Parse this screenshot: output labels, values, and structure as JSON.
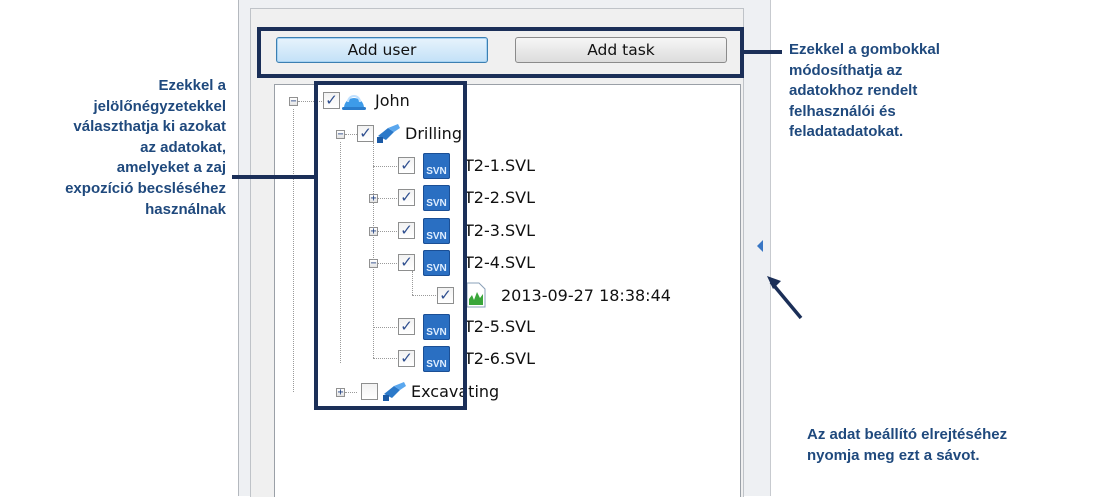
{
  "buttons": {
    "add_user": "Add user",
    "add_task": "Add task"
  },
  "tree": {
    "user": {
      "label": "John",
      "checked": true,
      "icon": "user-helmet-icon"
    },
    "task1": {
      "label": "Drilling",
      "checked": true,
      "icon": "drill-icon"
    },
    "files": [
      {
        "label": "T2-1.SVL",
        "checked": true,
        "icon": "svn-file-icon"
      },
      {
        "label": "T2-2.SVL",
        "checked": true,
        "icon": "svn-file-icon"
      },
      {
        "label": "T2-3.SVL",
        "checked": true,
        "icon": "svn-file-icon"
      },
      {
        "label": "T2-4.SVL",
        "checked": true,
        "icon": "svn-file-icon"
      }
    ],
    "measurement": {
      "label": "2013-09-27 18:38:44",
      "checked": true,
      "icon": "chart-document-icon"
    },
    "files2": [
      {
        "label": "T2-5.SVL",
        "checked": true,
        "icon": "svn-file-icon"
      },
      {
        "label": "T2-6.SVL",
        "checked": true,
        "icon": "svn-file-icon"
      }
    ],
    "task2": {
      "label": "Excavating",
      "checked": false,
      "icon": "drill-icon"
    },
    "svn_badge": "SVN"
  },
  "callouts": {
    "left": [
      "Ezekkel a",
      "jelölőnégyzetekkel",
      "választhatja ki azokat",
      "az adatokat,",
      "amelyeket a zaj",
      "expozíció becsléséhez",
      "használnak"
    ],
    "right": [
      "Ezekkel a gombokkal",
      "módosíthatja az",
      "adatokhoz rendelt",
      "felhasználói és",
      "feladatadatokat."
    ],
    "bottom": [
      "Az adat beállító elrejtéséhez",
      "nyomja meg ezt a sávot."
    ]
  },
  "colors": {
    "callout_text": "#1f497d",
    "frame": "#1b2f58",
    "selected_button": "#c3e1f7"
  }
}
